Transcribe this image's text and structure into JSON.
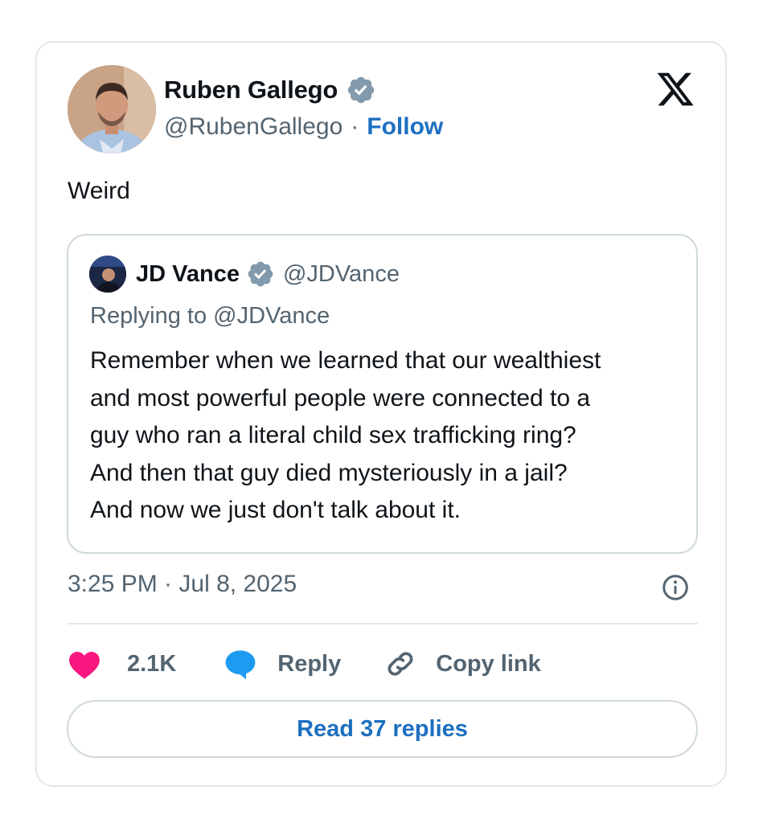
{
  "author": {
    "name": "Ruben Gallego",
    "handle": "@RubenGallego",
    "separator": "·",
    "follow_label": "Follow"
  },
  "tweet": {
    "text": "Weird",
    "timestamp": "3:25 PM · Jul 8, 2025"
  },
  "quoted": {
    "name": "JD Vance",
    "handle": "@JDVance",
    "replying_to": "Replying to @JDVance",
    "lines": [
      "Remember when we learned that our wealthiest",
      "and most powerful people were connected to a",
      "guy who ran a literal child sex trafficking ring?",
      "And then that guy died mysteriously in a jail?",
      "And now we just don't talk about it."
    ]
  },
  "actions": {
    "likes": "2.1K",
    "reply_label": "Reply",
    "copy_link_label": "Copy link"
  },
  "read_replies_label": "Read 37 replies",
  "icons": {
    "verified": "verified-badge-icon",
    "x_logo": "x-logo-icon",
    "info": "info-icon",
    "heart": "heart-icon",
    "reply": "reply-bubble-icon",
    "link": "link-icon"
  },
  "colors": {
    "verified_badge": "#829aab",
    "link_blue": "#1d6fc0",
    "heart_pink": "#f91880",
    "reply_blue": "#1d9bf0",
    "muted_text": "#536471",
    "border": "#cfd9de"
  }
}
